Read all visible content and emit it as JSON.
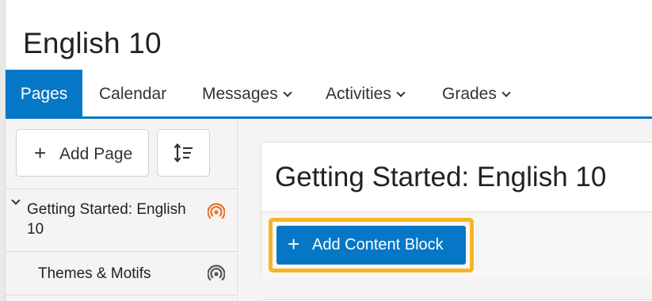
{
  "course": {
    "title": "English 10"
  },
  "nav": {
    "tabs": [
      {
        "label": "Pages",
        "active": true
      },
      {
        "label": "Calendar"
      },
      {
        "label": "Messages",
        "dropdown": true
      },
      {
        "label": "Activities",
        "dropdown": true
      },
      {
        "label": "Grades",
        "dropdown": true
      }
    ]
  },
  "sidebar": {
    "add_page_label": "Add Page",
    "sort_icon": "sort-order-icon",
    "pages": [
      {
        "label": "Getting Started: English 10",
        "expanded": true,
        "status_icon": "published-broadcast-icon",
        "status_color": "#e8722b"
      },
      {
        "label": "Themes & Motifs",
        "status_icon": "unpublished-broadcast-icon",
        "status_color": "#555555"
      }
    ]
  },
  "main": {
    "page_title": "Getting Started: English 10",
    "add_content_block_label": "Add Content Block"
  },
  "colors": {
    "brand": "#0677c6",
    "highlight": "#f7b426",
    "published": "#e8722b"
  }
}
